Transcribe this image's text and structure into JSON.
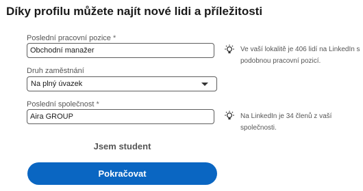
{
  "header": {
    "title": "Díky profilu můžete najít nové lidi a příležitosti"
  },
  "form": {
    "position": {
      "label": "Poslední pracovní pozice",
      "required_mark": "*",
      "value": "Obchodní manažer",
      "hint_line1": "Ve vaší lokalitě je 406 lidí na LinkedIn s",
      "hint_line2": "podobnou pracovní pozicí."
    },
    "employment_type": {
      "label": "Druh zaměstnání",
      "value": "Na plný úvazek"
    },
    "company": {
      "label": "Poslední společnost",
      "required_mark": "*",
      "value": "Aira GROUP",
      "hint": "Na LinkedIn je 34 členů z vaší společnosti."
    }
  },
  "actions": {
    "student_label": "Jsem student",
    "continue_label": "Pokračovat"
  },
  "icons": {
    "hint": "lightbulb-icon",
    "dropdown": "chevron-down-icon"
  },
  "colors": {
    "primary": "#0a66c2"
  }
}
